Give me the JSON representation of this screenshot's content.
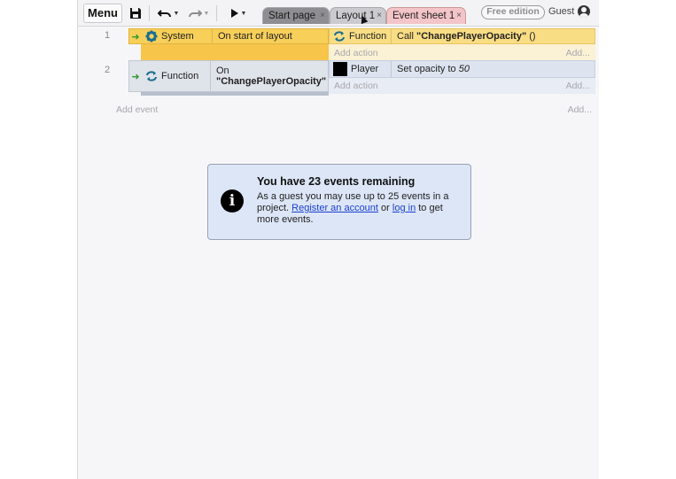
{
  "toolbar": {
    "menu_label": "Menu",
    "tabs": [
      {
        "label": "Start page",
        "close": "×"
      },
      {
        "label": "Layout 1",
        "close": "×"
      },
      {
        "label": "Event sheet 1",
        "close": "×"
      }
    ],
    "edition_badge": "Free edition",
    "user_label": "Guest"
  },
  "events": [
    {
      "number": "1",
      "condition": {
        "object": "System",
        "text": "On start of layout"
      },
      "action": {
        "object": "Function",
        "prefix": "Call ",
        "name": "\"ChangePlayerOpacity\"",
        "suffix": " ()"
      },
      "add_action": "Add action",
      "add_right": "Add..."
    },
    {
      "number": "2",
      "condition": {
        "object": "Function",
        "line1": "On",
        "line2": "\"ChangePlayerOpacity\""
      },
      "action": {
        "object": "Player",
        "prefix": "Set opacity to ",
        "value": "50"
      },
      "add_action": "Add action",
      "add_right": "Add..."
    }
  ],
  "add_event": {
    "label": "Add event",
    "right": "Add..."
  },
  "notice": {
    "title": "You have 23 events remaining",
    "body_1": "As a guest you may use up to 25 events in a project. ",
    "link_register": "Register an account",
    "body_2": " or ",
    "link_login": "log in",
    "body_3": " to get more events."
  },
  "colors": {
    "event1_condition": "#f7cf59",
    "event2_condition": "#dfe3ea",
    "notice_bg": "#dce6f7",
    "link": "#1a3fd0"
  }
}
